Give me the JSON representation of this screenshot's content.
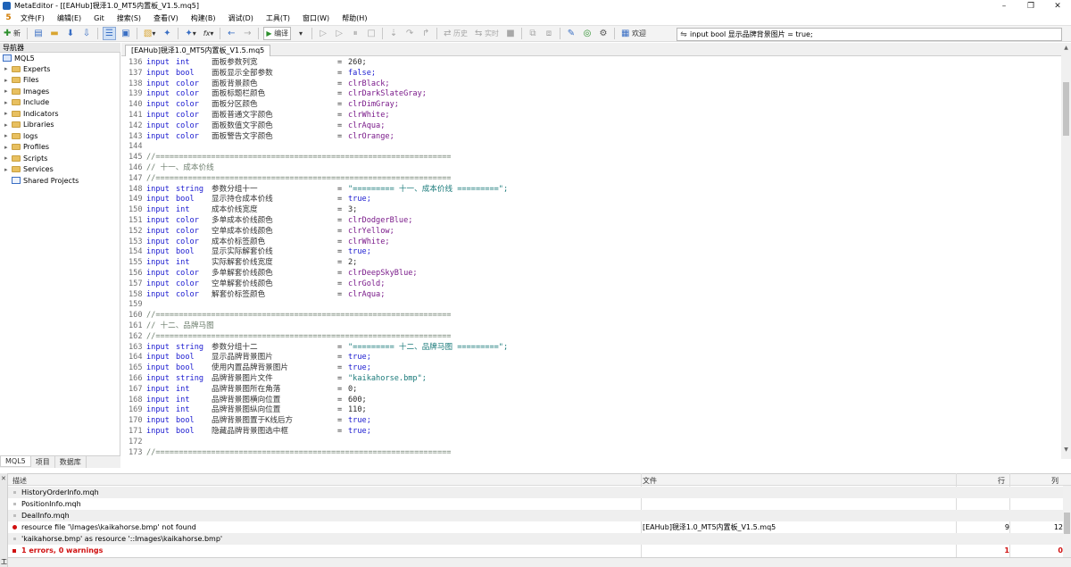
{
  "window": {
    "title": "MetaEditor - [[EAHub]覒泽1.0_MT5内置板_V1.5.mq5]",
    "min_glyph": "–",
    "restore_glyph": "❐",
    "close_glyph": "✕"
  },
  "menu": {
    "logo": "5",
    "items": [
      "文件(F)",
      "编辑(E)",
      "Git",
      "搜索(S)",
      "查看(V)",
      "构建(B)",
      "调试(D)",
      "工具(T)",
      "窗口(W)",
      "帮助(H)"
    ]
  },
  "toolbar": {
    "new_label": "新",
    "compile_label": "编译",
    "history_label": "历史",
    "realtime_label": "实时",
    "welcome_label": "欢迎",
    "search_value": "input bool 显示品牌背景图片 = true;",
    "icon_new": "✚",
    "icon_open": "▤",
    "icon_folder": "▬",
    "icon_save": "⬇",
    "icon_saveall": "⇩",
    "icon_navigator": "☰",
    "icon_view": "▣",
    "icon_db": "▧",
    "icon_sparkle": "✦",
    "icon_ai": "✦",
    "icon_fx": "fx",
    "icon_back": "←",
    "icon_fwd": "→",
    "icon_compile": "▶",
    "icon_play": "▷",
    "icon_play2": "▷",
    "icon_pause": "⏸",
    "icon_stop": "□",
    "icon_step": "⇣",
    "icon_stepover": "↷",
    "icon_stepout": "↱",
    "icon_history": "⇄",
    "icon_realtime": "⇆",
    "icon_stopall": "■",
    "icon_copy": "⧉",
    "icon_paste": "⧈",
    "icon_pen": "✎",
    "icon_target": "◎",
    "icon_gear": "⚙",
    "icon_welcome": "▦",
    "icon_search": "⇋"
  },
  "navigator": {
    "header": "导航器",
    "root": "MQL5",
    "items": [
      "Experts",
      "Files",
      "Images",
      "Include",
      "Indicators",
      "Libraries",
      "logs",
      "Profiles",
      "Scripts",
      "Services"
    ],
    "shared": "Shared Projects",
    "tabs": [
      "MQL5",
      "项目",
      "数据库"
    ]
  },
  "document": {
    "tab_label": "[EAHub]覒泽1.0_MT5内置板_V1.5.mq5"
  },
  "code": [
    {
      "n": "136",
      "kw": "input",
      "type": "int",
      "name": "面板参数列宽",
      "eq": "=",
      "val": "260;",
      "vk": "num"
    },
    {
      "n": "137",
      "kw": "input",
      "type": "bool",
      "name": "面板显示全部参数",
      "eq": "=",
      "val": "false;",
      "vk": "bool"
    },
    {
      "n": "138",
      "kw": "input",
      "type": "color",
      "name": "面板背景颜色",
      "eq": "=",
      "val": "clrBlack;",
      "vk": "clr"
    },
    {
      "n": "139",
      "kw": "input",
      "type": "color",
      "name": "面板标题栏颜色",
      "eq": "=",
      "val": "clrDarkSlateGray;",
      "vk": "clr"
    },
    {
      "n": "140",
      "kw": "input",
      "type": "color",
      "name": "面板分区颜色",
      "eq": "=",
      "val": "clrDimGray;",
      "vk": "clr"
    },
    {
      "n": "141",
      "kw": "input",
      "type": "color",
      "name": "面板普通文字颜色",
      "eq": "=",
      "val": "clrWhite;",
      "vk": "clr"
    },
    {
      "n": "142",
      "kw": "input",
      "type": "color",
      "name": "面板数值文字颜色",
      "eq": "=",
      "val": "clrAqua;",
      "vk": "clr"
    },
    {
      "n": "143",
      "kw": "input",
      "type": "color",
      "name": "面板警告文字颜色",
      "eq": "=",
      "val": "clrOrange;",
      "vk": "clr"
    },
    {
      "n": "144",
      "comment": ""
    },
    {
      "n": "145",
      "comment": "//================================================================"
    },
    {
      "n": "146",
      "comment": "// 十一、成本价线"
    },
    {
      "n": "147",
      "comment": "//================================================================"
    },
    {
      "n": "148",
      "kw": "input",
      "type": "string",
      "name": "参数分组十一",
      "eq": "=",
      "val": "\"========= 十一、成本价线 =========\";",
      "vk": "str"
    },
    {
      "n": "149",
      "kw": "input",
      "type": "bool",
      "name": "显示持仓成本价线",
      "eq": "=",
      "val": "true;",
      "vk": "bool"
    },
    {
      "n": "150",
      "kw": "input",
      "type": "int",
      "name": "成本价线宽度",
      "eq": "=",
      "val": "3;",
      "vk": "num"
    },
    {
      "n": "151",
      "kw": "input",
      "type": "color",
      "name": "多单成本价线颜色",
      "eq": "=",
      "val": "clrDodgerBlue;",
      "vk": "clr"
    },
    {
      "n": "152",
      "kw": "input",
      "type": "color",
      "name": "空单成本价线颜色",
      "eq": "=",
      "val": "clrYellow;",
      "vk": "clr"
    },
    {
      "n": "153",
      "kw": "input",
      "type": "color",
      "name": "成本价标签颜色",
      "eq": "=",
      "val": "clrWhite;",
      "vk": "clr"
    },
    {
      "n": "154",
      "kw": "input",
      "type": "bool",
      "name": "显示实际解套价线",
      "eq": "=",
      "val": "true;",
      "vk": "bool"
    },
    {
      "n": "155",
      "kw": "input",
      "type": "int",
      "name": "实际解套价线宽度",
      "eq": "=",
      "val": "2;",
      "vk": "num"
    },
    {
      "n": "156",
      "kw": "input",
      "type": "color",
      "name": "多单解套价线颜色",
      "eq": "=",
      "val": "clrDeepSkyBlue;",
      "vk": "clr"
    },
    {
      "n": "157",
      "kw": "input",
      "type": "color",
      "name": "空单解套价线颜色",
      "eq": "=",
      "val": "clrGold;",
      "vk": "clr"
    },
    {
      "n": "158",
      "kw": "input",
      "type": "color",
      "name": "解套价标签颜色",
      "eq": "=",
      "val": "clrAqua;",
      "vk": "clr"
    },
    {
      "n": "159",
      "comment": ""
    },
    {
      "n": "160",
      "comment": "//================================================================"
    },
    {
      "n": "161",
      "comment": "// 十二、品牌马图"
    },
    {
      "n": "162",
      "comment": "//================================================================"
    },
    {
      "n": "163",
      "kw": "input",
      "type": "string",
      "name": "参数分组十二",
      "eq": "=",
      "val": "\"========= 十二、品牌马图 =========\";",
      "vk": "str"
    },
    {
      "n": "164",
      "kw": "input",
      "type": "bool",
      "name": "显示品牌背景图片",
      "eq": "=",
      "val": "true;",
      "vk": "bool"
    },
    {
      "n": "165",
      "kw": "input",
      "type": "bool",
      "name": "使用内置品牌背景图片",
      "eq": "=",
      "val": "true;",
      "vk": "bool"
    },
    {
      "n": "166",
      "kw": "input",
      "type": "string",
      "name": "品牌背景图片文件",
      "eq": "=",
      "val": "\"kaikahorse.bmp\";",
      "vk": "str"
    },
    {
      "n": "167",
      "kw": "input",
      "type": "int",
      "name": "品牌背景图所在角落",
      "eq": "=",
      "val": "0;",
      "vk": "num"
    },
    {
      "n": "168",
      "kw": "input",
      "type": "int",
      "name": "品牌背景图横向位置",
      "eq": "=",
      "val": "600;",
      "vk": "num"
    },
    {
      "n": "169",
      "kw": "input",
      "type": "int",
      "name": "品牌背景图纵向位置",
      "eq": "=",
      "val": "110;",
      "vk": "num"
    },
    {
      "n": "170",
      "kw": "input",
      "type": "bool",
      "name": "品牌背景图置于K线后方",
      "eq": "=",
      "val": "true;",
      "vk": "bool"
    },
    {
      "n": "171",
      "kw": "input",
      "type": "bool",
      "name": "隐藏品牌背景图选中框",
      "eq": "=",
      "val": "true;",
      "vk": "bool"
    },
    {
      "n": "172",
      "comment": ""
    },
    {
      "n": "173",
      "comment": "//================================================================"
    }
  ],
  "output": {
    "col_desc": "描述",
    "col_file": "文件",
    "col_line": "行",
    "col_col": "列",
    "rows": [
      {
        "desc": "HistoryOrderInfo.mqh",
        "file": "",
        "line": "",
        "col": "",
        "kind": "info"
      },
      {
        "desc": "PositionInfo.mqh",
        "file": "",
        "line": "",
        "col": "",
        "kind": "info"
      },
      {
        "desc": "DealInfo.mqh",
        "file": "",
        "line": "",
        "col": "",
        "kind": "info"
      },
      {
        "desc": "resource file '\\Images\\kaikahorse.bmp' not found",
        "file": "[EAHub]覒泽1.0_MT5内置板_V1.5.mq5",
        "line": "9",
        "col": "12",
        "kind": "error"
      },
      {
        "desc": "'kaikahorse.bmp' as resource '::Images\\kaikahorse.bmp'",
        "file": "",
        "line": "",
        "col": "",
        "kind": "info"
      },
      {
        "desc": "1 errors, 0 warnings",
        "file": "",
        "line": "1",
        "col": "0",
        "kind": "summary"
      }
    ],
    "side_label": "工"
  },
  "colors": {
    "keyword": "#1a1ad0",
    "color_const": "#7a1a8a",
    "string": "#1a7a7a",
    "comment": "#708070",
    "error": "#d01010"
  }
}
